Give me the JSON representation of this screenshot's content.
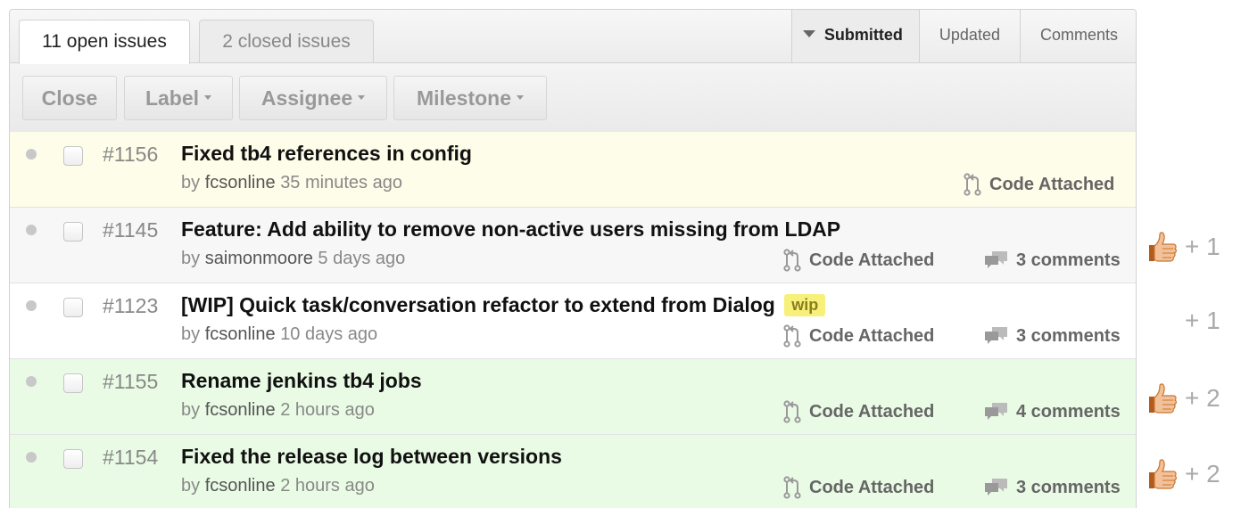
{
  "tabs": {
    "open": "11 open issues",
    "closed": "2 closed issues"
  },
  "sort": {
    "submitted": "Submitted",
    "updated": "Updated",
    "comments": "Comments"
  },
  "toolbar": {
    "close": "Close",
    "label": "Label",
    "assignee": "Assignee",
    "milestone": "Milestone"
  },
  "issues": [
    {
      "number": "#1156",
      "title": "Fixed tb4 references in config",
      "label": "",
      "by": "by",
      "author": "fcsonline",
      "time": "35 minutes ago",
      "code": "Code Attached",
      "comments": "",
      "votes": "",
      "background": "#fdfde9"
    },
    {
      "number": "#1145",
      "title": "Feature: Add ability to remove non-active users missing from LDAP",
      "label": "",
      "by": "by",
      "author": "saimonmoore",
      "time": "5 days ago",
      "code": "Code Attached",
      "comments": "3 comments",
      "votes": "+ 1",
      "background": "#f7f7f7"
    },
    {
      "number": "#1123",
      "title": "[WIP] Quick task/conversation refactor to extend from Dialog",
      "label": "wip",
      "by": "by",
      "author": "fcsonline",
      "time": "10 days ago",
      "code": "Code Attached",
      "comments": "3 comments",
      "votes": "+ 1",
      "background": "#ffffff"
    },
    {
      "number": "#1155",
      "title": "Rename jenkins tb4 jobs",
      "label": "",
      "by": "by",
      "author": "fcsonline",
      "time": "2 hours ago",
      "code": "Code Attached",
      "comments": "4 comments",
      "votes": "+ 2",
      "background": "#e9fbe5"
    },
    {
      "number": "#1154",
      "title": "Fixed the release log between versions",
      "label": "",
      "by": "by",
      "author": "fcsonline",
      "time": "2 hours ago",
      "code": "Code Attached",
      "comments": "3 comments",
      "votes": "+ 2",
      "background": "#e9fbe5"
    }
  ],
  "icons": {
    "code": "pull-request-icon",
    "comments": "comment-icon",
    "vote": "thumbs-up-icon"
  },
  "colors": {
    "label_wip_bg": "#f7f07a",
    "vote_text": "#aaaaaa"
  }
}
